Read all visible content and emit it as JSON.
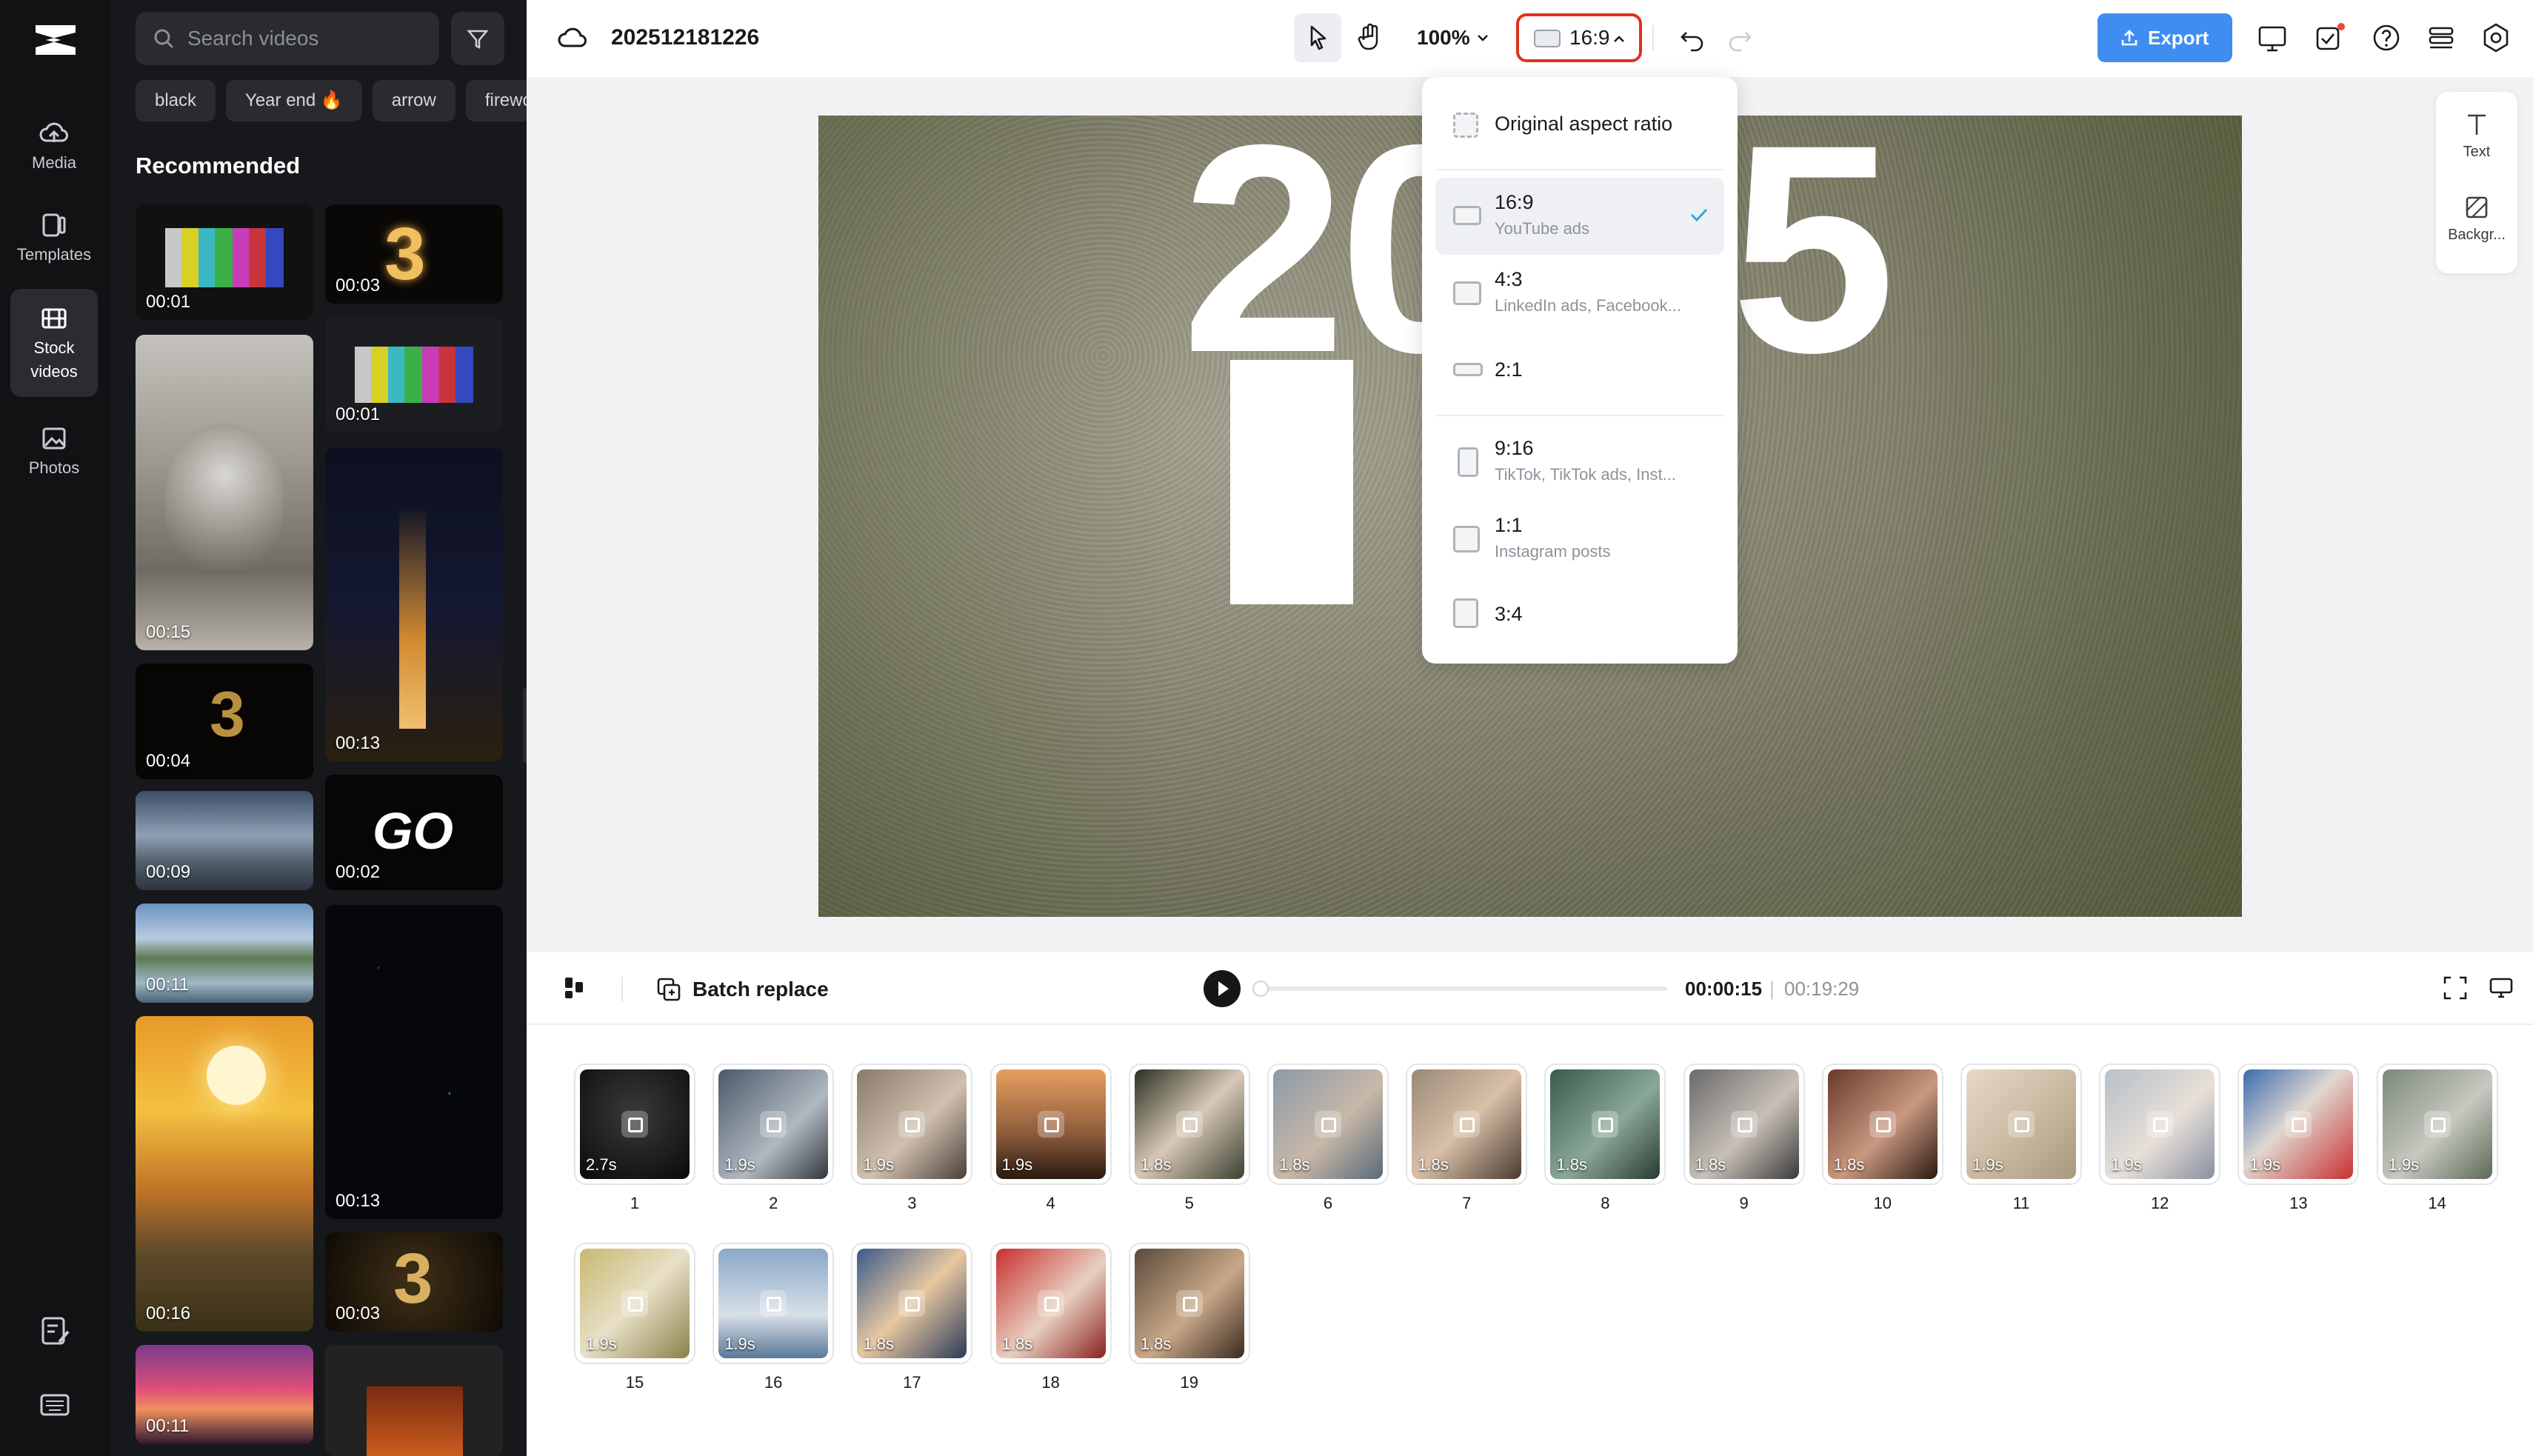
{
  "app": {
    "project_title": "202512181226"
  },
  "left_nav": {
    "items": [
      {
        "label": "Media",
        "icon": "cloud-upload-icon"
      },
      {
        "label": "Templates",
        "icon": "templates-icon"
      },
      {
        "label": "Stock videos",
        "icon": "film-icon",
        "active": true
      },
      {
        "label": "Photos",
        "icon": "image-icon"
      }
    ]
  },
  "panel": {
    "search_placeholder": "Search videos",
    "chips": [
      "black",
      "Year end 🔥",
      "arrow",
      "fireworks"
    ],
    "section_title": "Recommended",
    "thumbs": [
      {
        "duration": "00:01",
        "theme": "color-bars"
      },
      {
        "duration": "00:03",
        "theme": "gold-three"
      },
      {
        "duration": "00:15",
        "theme": "cat"
      },
      {
        "duration": "00:01",
        "theme": "color-bars"
      },
      {
        "duration": "00:13",
        "theme": "city-night"
      },
      {
        "duration": "00:04",
        "theme": "gold-three-dark"
      },
      {
        "duration": "00:09",
        "theme": "clouds"
      },
      {
        "duration": "00:02",
        "theme": "go-text"
      },
      {
        "duration": "00:11",
        "theme": "lake"
      },
      {
        "duration": "00:13",
        "theme": "stars"
      },
      {
        "duration": "00:16",
        "theme": "sunset"
      },
      {
        "duration": "00:03",
        "theme": "gold-three"
      },
      {
        "duration": "00:11",
        "theme": "pink-sky"
      },
      {
        "duration": "",
        "theme": "dark-orange"
      }
    ]
  },
  "toolbar": {
    "zoom": "100%",
    "aspect_ratio": "16:9",
    "export_label": "Export"
  },
  "canvas": {
    "overlay_text_left": "20",
    "overlay_text_right": "5"
  },
  "right_rail": [
    {
      "label": "Text",
      "icon": "text-icon"
    },
    {
      "label": "Backgr...",
      "icon": "background-icon"
    }
  ],
  "aspect_menu": {
    "items": [
      {
        "label": "Original aspect ratio",
        "sub": ""
      },
      {
        "label": "16:9",
        "sub": "YouTube ads",
        "selected": true
      },
      {
        "label": "4:3",
        "sub": "LinkedIn ads, Facebook..."
      },
      {
        "label": "2:1",
        "sub": ""
      },
      {
        "label": "9:16",
        "sub": "TikTok, TikTok ads, Inst..."
      },
      {
        "label": "1:1",
        "sub": "Instagram posts"
      },
      {
        "label": "3:4",
        "sub": ""
      }
    ]
  },
  "playback": {
    "batch_replace_label": "Batch replace",
    "current_time": "00:00:15",
    "separator": "|",
    "total_time": "00:19:29"
  },
  "clips": [
    {
      "num": "1",
      "duration": "2.7s"
    },
    {
      "num": "2",
      "duration": "1.9s"
    },
    {
      "num": "3",
      "duration": "1.9s"
    },
    {
      "num": "4",
      "duration": "1.9s"
    },
    {
      "num": "5",
      "duration": "1.8s"
    },
    {
      "num": "6",
      "duration": "1.8s"
    },
    {
      "num": "7",
      "duration": "1.8s"
    },
    {
      "num": "8",
      "duration": "1.8s"
    },
    {
      "num": "9",
      "duration": "1.8s"
    },
    {
      "num": "10",
      "duration": "1.8s"
    },
    {
      "num": "11",
      "duration": "1.9s"
    },
    {
      "num": "12",
      "duration": "1.9s"
    },
    {
      "num": "13",
      "duration": "1.9s"
    },
    {
      "num": "14",
      "duration": "1.9s"
    },
    {
      "num": "15",
      "duration": "1.9s"
    },
    {
      "num": "16",
      "duration": "1.9s"
    },
    {
      "num": "17",
      "duration": "1.8s"
    },
    {
      "num": "18",
      "duration": "1.8s"
    },
    {
      "num": "19",
      "duration": "1.8s"
    }
  ],
  "colors": {
    "accent": "#3f8df0",
    "highlight_border": "#e0311c",
    "check": "#2fa8d6"
  }
}
